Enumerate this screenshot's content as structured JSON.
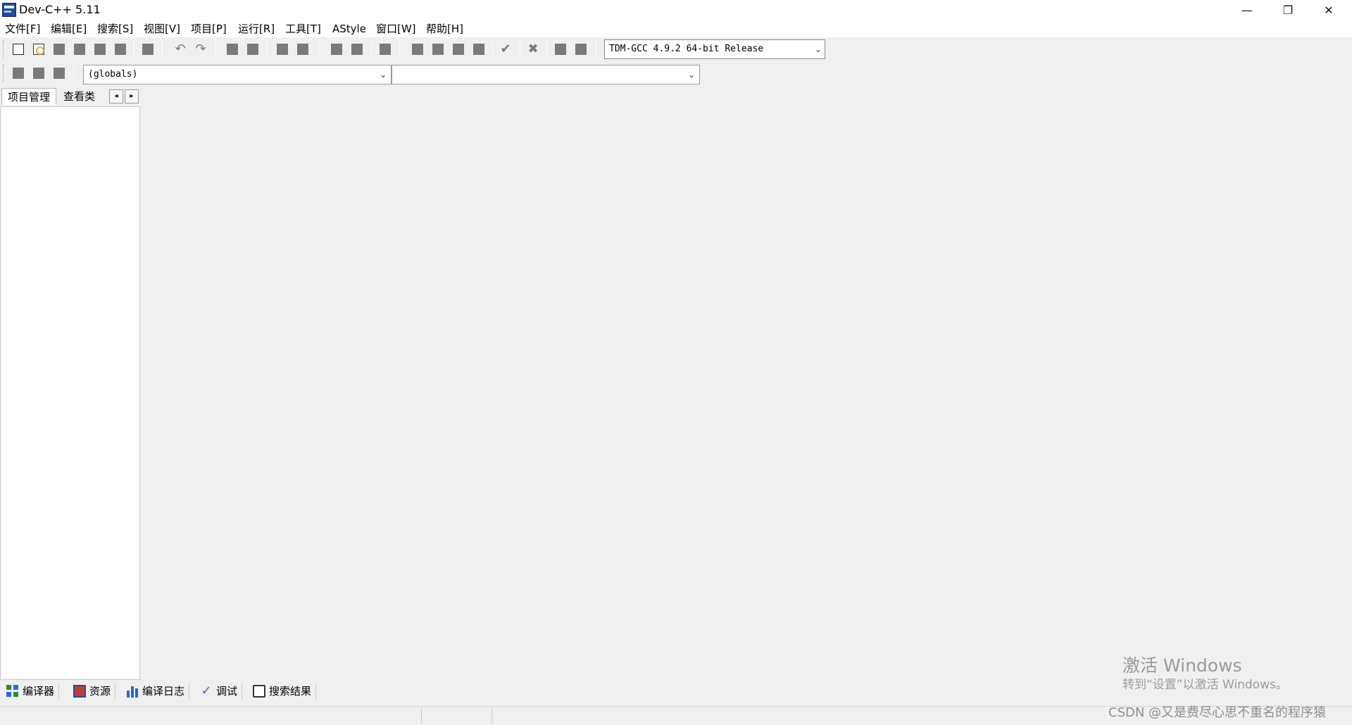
{
  "window": {
    "title": "Dev-C++ 5.11",
    "min_glyph": "—",
    "max_glyph": "❐",
    "close_glyph": "✕"
  },
  "menu": [
    "文件[F]",
    "编辑[E]",
    "搜索[S]",
    "视图[V]",
    "项目[P]",
    "运行[R]",
    "工具[T]",
    "AStyle",
    "窗口[W]",
    "帮助[H]"
  ],
  "toolbar": {
    "compiler": "TDM-GCC 4.9.2 64-bit Release",
    "scope": "(globals)",
    "members": "",
    "dropdown_arrow": "⌄",
    "undo_glyph": "↶",
    "redo_glyph": "↷",
    "compile_check_glyph": "✔",
    "stop_glyph": "✖"
  },
  "left_panel": {
    "tabs": [
      "项目管理",
      "查看类"
    ],
    "scroll_left": "◂",
    "scroll_right": "▸"
  },
  "bottom_tabs": [
    "编译器",
    "资源",
    "编译日志",
    "调试",
    "搜索结果"
  ],
  "bottom_tab_check_glyph": "✓",
  "overlay": {
    "activate_title": "激活 Windows",
    "activate_subtitle": "转到“设置”以激活 Windows。",
    "watermark": "CSDN @又是费尽心思不重名的程序猿"
  },
  "colors": {
    "background": "#f0f0f0",
    "panel": "#ffffff",
    "watermark": "#9a9a9a"
  }
}
